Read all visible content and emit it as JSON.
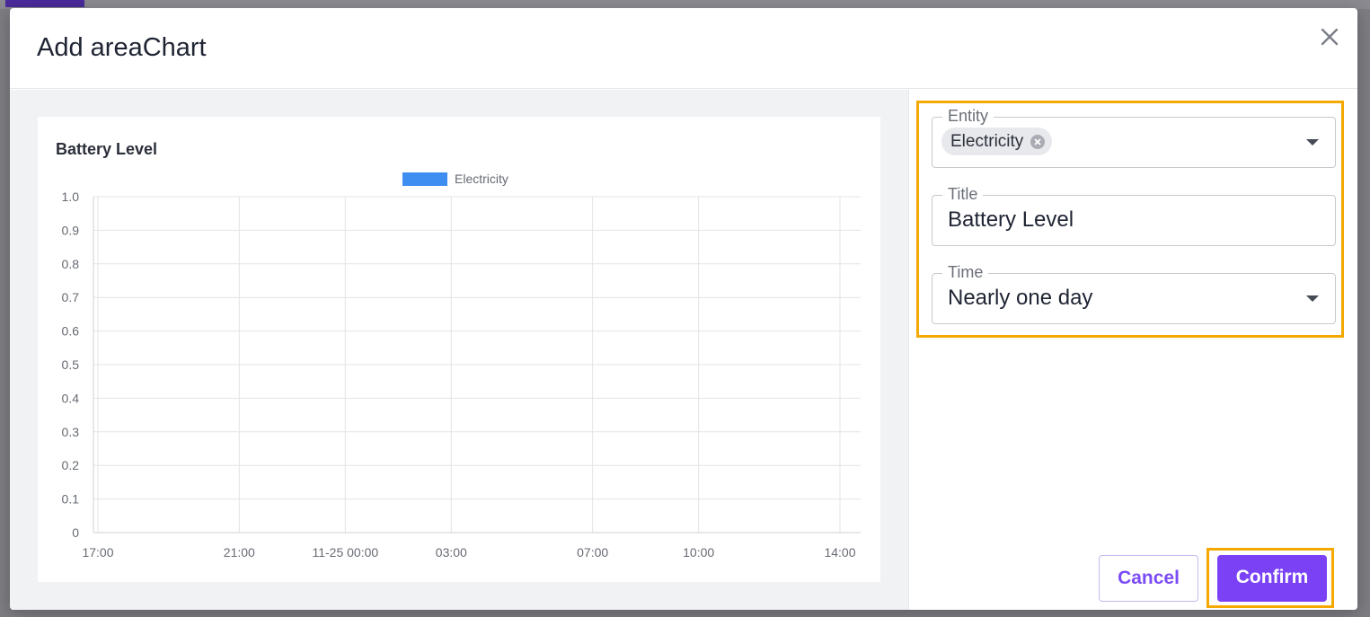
{
  "dialog": {
    "title": "Add areaChart",
    "close_icon": "close-icon"
  },
  "form": {
    "entity": {
      "label": "Entity",
      "chip": "Electricity"
    },
    "title": {
      "label": "Title",
      "value": "Battery Level"
    },
    "time": {
      "label": "Time",
      "value": "Nearly one day"
    }
  },
  "buttons": {
    "cancel": "Cancel",
    "confirm": "Confirm"
  },
  "colors": {
    "accent": "#7b42f5",
    "highlight": "#f5a800",
    "series": "#3d8ef0"
  },
  "chart_data": {
    "type": "area",
    "title": "Battery Level",
    "legend": [
      "Electricity"
    ],
    "legend_position": "top-center",
    "ylim": [
      0,
      1.0
    ],
    "y_ticks": [
      "1.0",
      "0.9",
      "0.8",
      "0.7",
      "0.6",
      "0.5",
      "0.4",
      "0.3",
      "0.2",
      "0.1",
      "0"
    ],
    "x_ticks": [
      "17:00",
      "21:00",
      "11-25 00:00",
      "03:00",
      "07:00",
      "10:00",
      "14:00"
    ],
    "grid": true,
    "series": [
      {
        "name": "Electricity",
        "values": []
      }
    ]
  }
}
